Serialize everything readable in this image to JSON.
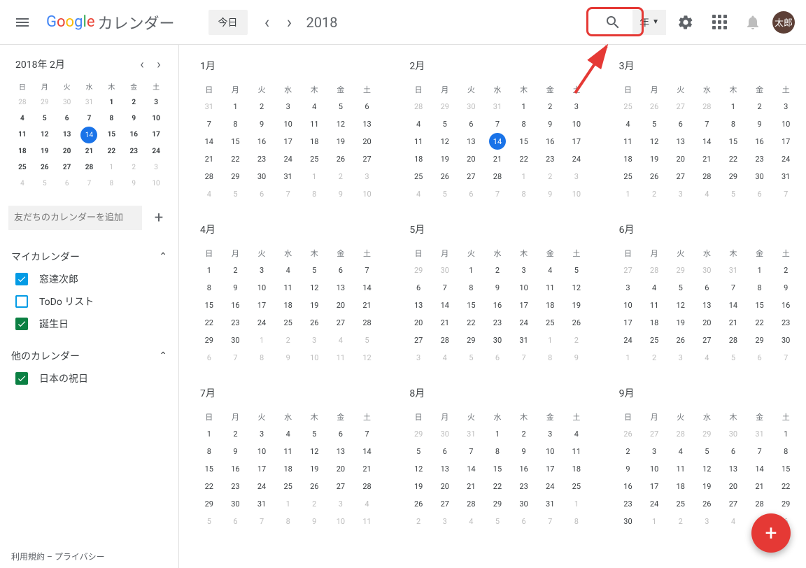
{
  "header": {
    "app_name": "カレンダー",
    "today_label": "今日",
    "year": "2018",
    "view_label": "年",
    "avatar": "太郎"
  },
  "sidebar": {
    "mini_title": "2018年 2月",
    "day_headers": [
      "日",
      "月",
      "火",
      "水",
      "木",
      "金",
      "土"
    ],
    "mini_days": [
      {
        "n": 28,
        "o": 1
      },
      {
        "n": 29,
        "o": 1
      },
      {
        "n": 30,
        "o": 1
      },
      {
        "n": 31,
        "o": 1
      },
      {
        "n": 1,
        "b": 1
      },
      {
        "n": 2,
        "b": 1
      },
      {
        "n": 3,
        "b": 1
      },
      {
        "n": 4,
        "b": 1
      },
      {
        "n": 5,
        "b": 1
      },
      {
        "n": 6,
        "b": 1
      },
      {
        "n": 7,
        "b": 1
      },
      {
        "n": 8,
        "b": 1
      },
      {
        "n": 9,
        "b": 1
      },
      {
        "n": 10,
        "b": 1
      },
      {
        "n": 11,
        "b": 1
      },
      {
        "n": 12,
        "b": 1
      },
      {
        "n": 13,
        "b": 1
      },
      {
        "n": 14,
        "t": 1
      },
      {
        "n": 15,
        "b": 1
      },
      {
        "n": 16,
        "b": 1
      },
      {
        "n": 17,
        "b": 1
      },
      {
        "n": 18,
        "b": 1
      },
      {
        "n": 19,
        "b": 1
      },
      {
        "n": 20,
        "b": 1
      },
      {
        "n": 21,
        "b": 1
      },
      {
        "n": 22,
        "b": 1
      },
      {
        "n": 23,
        "b": 1
      },
      {
        "n": 24,
        "b": 1
      },
      {
        "n": 25,
        "b": 1
      },
      {
        "n": 26,
        "b": 1
      },
      {
        "n": 27,
        "b": 1
      },
      {
        "n": 28,
        "b": 1
      },
      {
        "n": 1,
        "o": 1
      },
      {
        "n": 2,
        "o": 1
      },
      {
        "n": 3,
        "o": 1
      },
      {
        "n": 4,
        "o": 1
      },
      {
        "n": 5,
        "o": 1
      },
      {
        "n": 6,
        "o": 1
      },
      {
        "n": 7,
        "o": 1
      },
      {
        "n": 8,
        "o": 1
      },
      {
        "n": 9,
        "o": 1
      },
      {
        "n": 10,
        "o": 1
      }
    ],
    "add_friend_placeholder": "友だちのカレンダーを追加",
    "my_calendars_label": "マイカレンダー",
    "my_calendars": [
      {
        "label": "窓達次郎",
        "checked": true,
        "color": "blue"
      },
      {
        "label": "ToDo リスト",
        "checked": false,
        "color": "blue"
      },
      {
        "label": "誕生日",
        "checked": true,
        "color": "green"
      }
    ],
    "other_calendars_label": "他のカレンダー",
    "other_calendars": [
      {
        "label": "日本の祝日",
        "checked": true,
        "color": "green"
      }
    ],
    "footer": "利用規約 – プライバシー"
  },
  "months": [
    {
      "title": "1月",
      "first_dow": 1,
      "days": 31,
      "prev_days": 31,
      "today": 0
    },
    {
      "title": "2月",
      "first_dow": 4,
      "days": 28,
      "prev_days": 31,
      "today": 14
    },
    {
      "title": "3月",
      "first_dow": 4,
      "days": 31,
      "prev_days": 28,
      "today": 0
    },
    {
      "title": "4月",
      "first_dow": 0,
      "days": 30,
      "prev_days": 31,
      "today": 0
    },
    {
      "title": "5月",
      "first_dow": 2,
      "days": 31,
      "prev_days": 30,
      "today": 0
    },
    {
      "title": "6月",
      "first_dow": 5,
      "days": 30,
      "prev_days": 31,
      "today": 0
    },
    {
      "title": "7月",
      "first_dow": 0,
      "days": 31,
      "prev_days": 30,
      "today": 0
    },
    {
      "title": "8月",
      "first_dow": 3,
      "days": 31,
      "prev_days": 31,
      "today": 0
    },
    {
      "title": "9月",
      "first_dow": 6,
      "days": 30,
      "prev_days": 31,
      "today": 0
    }
  ]
}
